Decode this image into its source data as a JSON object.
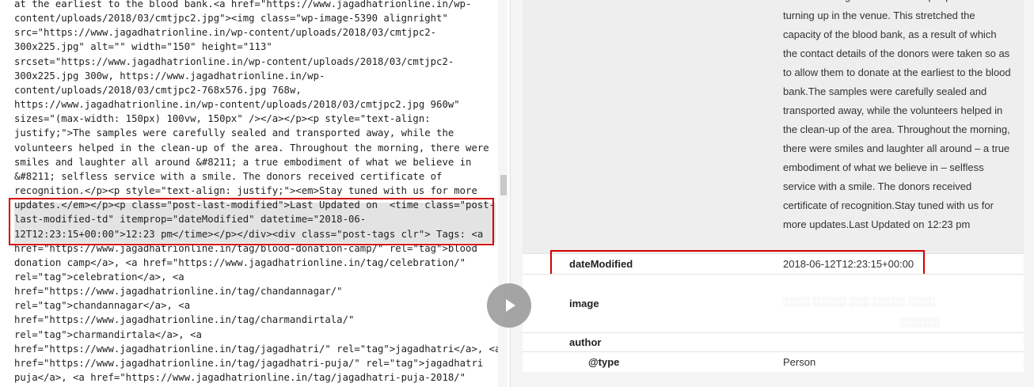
{
  "source_view": {
    "lines": [
      "at the earliest to the blood bank.<a href=\"https://www.jagadhatrionline.in/wp-",
      "content/uploads/2018/03/cmtjpc2.jpg\"><img class=\"wp-image-5390 alignright\"",
      "src=\"https://www.jagadhatrionline.in/wp-content/uploads/2018/03/cmtjpc2-",
      "300x225.jpg\" alt=\"\" width=\"150\" height=\"113\"",
      "srcset=\"https://www.jagadhatrionline.in/wp-content/uploads/2018/03/cmtjpc2-",
      "300x225.jpg 300w, https://www.jagadhatrionline.in/wp-",
      "content/uploads/2018/03/cmtjpc2-768x576.jpg 768w,",
      "https://www.jagadhatrionline.in/wp-content/uploads/2018/03/cmtjpc2.jpg 960w\"",
      "sizes=\"(max-width: 150px) 100vw, 150px\" /></a></p><p style=\"text-align:",
      "justify;\">The samples were carefully sealed and transported away, while the",
      "volunteers helped in the clean-up of the area. Throughout the morning, there were",
      "smiles and laughter all around &#8211; a true embodiment of what we believe in",
      "&#8211; selfless service with a smile. The donors received certificate of",
      "recognition.</p><p style=\"text-align: justify;\"><em>Stay tuned with us for more",
      "updates.</em></p><p class=\"post-last-modified\">Last Updated on  <time class=\"post-",
      "last-modified-td\" itemprop=\"dateModified\" datetime=\"2018-06-",
      "12T12:23:15+00:00\">12:23 pm</time></p></div><div class=\"post-tags clr\"> Tags: <a",
      "href=\"https://www.jagadhatrionline.in/tag/blood-donation-camp/\" rel=\"tag\">blood",
      "donation camp</a>, <a href=\"https://www.jagadhatrionline.in/tag/celebration/\"",
      "rel=\"tag\">celebration</a>, <a",
      "href=\"https://www.jagadhatrionline.in/tag/chandannagar/\"",
      "rel=\"tag\">chandannagar</a>, <a",
      "href=\"https://www.jagadhatrionline.in/tag/charmandirtala/\"",
      "rel=\"tag\">charmandirtala</a>, <a",
      "href=\"https://www.jagadhatrionline.in/tag/jagadhatri/\" rel=\"tag\">jagadhatri</a>, <a",
      "href=\"https://www.jagadhatrionline.in/tag/jagadhatri-puja/\" rel=\"tag\">jagadhatri",
      "puja</a>, <a href=\"https://www.jagadhatrionline.in/tag/jagadhatri-puja-2018/\""
    ],
    "text": ""
  },
  "structured_data": {
    "description_value": "a carrier was great to see more people than so turning up in the venue. This stretched the capacity of the blood bank, as a result of which the contact details of the donors were taken so as to allow them to donate at the earliest to the blood bank.The samples were carefully sealed and transported away, while the volunteers helped in the clean-up of the area. Throughout the morning, there were smiles and laughter all around – a true embodiment of what we believe in – selfless service with a smile. The donors received certificate of recognition.Stay tuned with us for more updates.Last Updated on 12:23 pm",
    "date_modified": {
      "key": "dateModified",
      "value": "2018-06-12T12:23:15+00:00"
    },
    "image": {
      "key": "image"
    },
    "author": {
      "key": "author"
    },
    "author_type": {
      "key": "@type",
      "value": "Person"
    }
  },
  "player": {
    "icon": "play-icon",
    "color": "#9e9e9e"
  },
  "colors": {
    "highlight_box": "#d40000",
    "selection": "#e3e3e3"
  }
}
